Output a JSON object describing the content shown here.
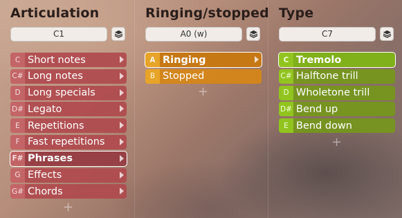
{
  "columns": [
    {
      "title": "Articulation",
      "key": "C1",
      "items": [
        {
          "key": "C",
          "label": "Short notes",
          "selected": false
        },
        {
          "key": "C#",
          "label": "Long notes",
          "selected": false
        },
        {
          "key": "D",
          "label": "Long specials",
          "selected": false
        },
        {
          "key": "D#",
          "label": "Legato",
          "selected": false
        },
        {
          "key": "E",
          "label": "Repetitions",
          "selected": false
        },
        {
          "key": "F",
          "label": "Fast repetitions",
          "selected": false
        },
        {
          "key": "F#",
          "label": "Phrases",
          "selected": true
        },
        {
          "key": "G",
          "label": "Effects",
          "selected": false
        },
        {
          "key": "G#",
          "label": "Chords",
          "selected": false
        }
      ],
      "add_label": "+"
    },
    {
      "title": "Ringing/stopped",
      "key": "A0 (w)",
      "items": [
        {
          "key": "A",
          "label": "Ringing",
          "selected": true
        },
        {
          "key": "B",
          "label": "Stopped",
          "selected": false
        }
      ],
      "add_label": "+"
    },
    {
      "title": "Type",
      "key": "C7",
      "items": [
        {
          "key": "C",
          "label": "Tremolo",
          "selected": true
        },
        {
          "key": "C#",
          "label": "Halftone trill",
          "selected": false
        },
        {
          "key": "D",
          "label": "Wholetone trill",
          "selected": false
        },
        {
          "key": "D#",
          "label": "Bend up",
          "selected": false
        },
        {
          "key": "E",
          "label": "Bend down",
          "selected": false
        }
      ],
      "add_label": "+"
    }
  ],
  "colors": {
    "articulation": "#b04a4e",
    "ringing": "#d48618",
    "type": "#76961e"
  },
  "icons": {
    "layer": "layers-icon",
    "submenu": "chevron-right-icon"
  }
}
